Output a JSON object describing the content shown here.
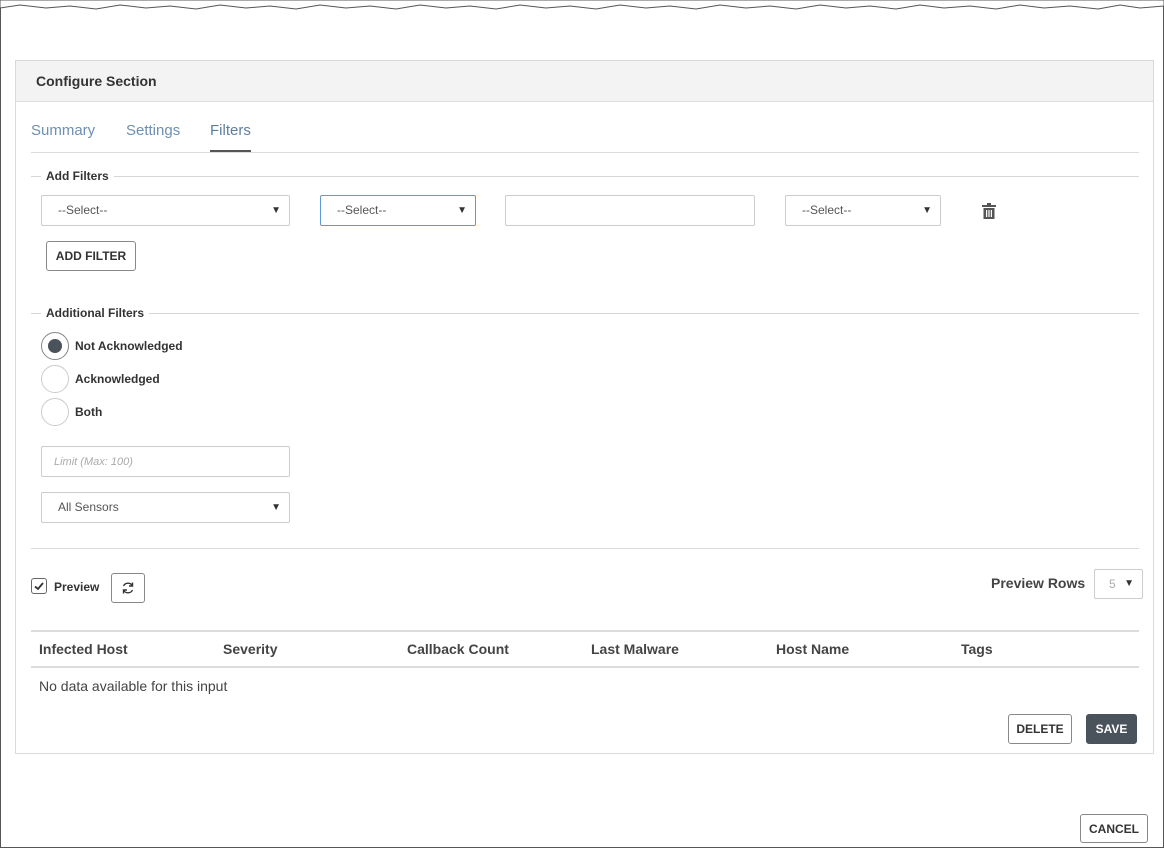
{
  "panel": {
    "title": "Configure Section"
  },
  "tabs": [
    {
      "label": "Summary"
    },
    {
      "label": "Settings"
    },
    {
      "label": "Filters"
    }
  ],
  "add_filters": {
    "legend": "Add Filters",
    "field_select": "--Select--",
    "operator_select": "--Select--",
    "value_input": "",
    "join_select": "--Select--",
    "add_button": "ADD FILTER",
    "delete_icon": "trash-icon"
  },
  "additional_filters": {
    "legend": "Additional Filters",
    "options": [
      {
        "label": "Not Acknowledged",
        "checked": true
      },
      {
        "label": "Acknowledged",
        "checked": false
      },
      {
        "label": "Both",
        "checked": false
      }
    ],
    "limit_placeholder": "Limit (Max: 100)",
    "sensors_select": "All Sensors"
  },
  "preview": {
    "label": "Preview",
    "checked": true,
    "refresh_icon": "refresh-icon",
    "rows_label": "Preview Rows",
    "rows_value": "5"
  },
  "table": {
    "columns": [
      "Infected Host",
      "Severity",
      "Callback Count",
      "Last Malware",
      "Host Name",
      "Tags"
    ],
    "empty_message": "No data available for this input"
  },
  "actions": {
    "delete": "DELETE",
    "save": "SAVE",
    "cancel": "CANCEL"
  },
  "colors": {
    "accent_tab": "#6d8fb3",
    "dark_button": "#4a525c",
    "focus_border": "#5b9bd5"
  }
}
